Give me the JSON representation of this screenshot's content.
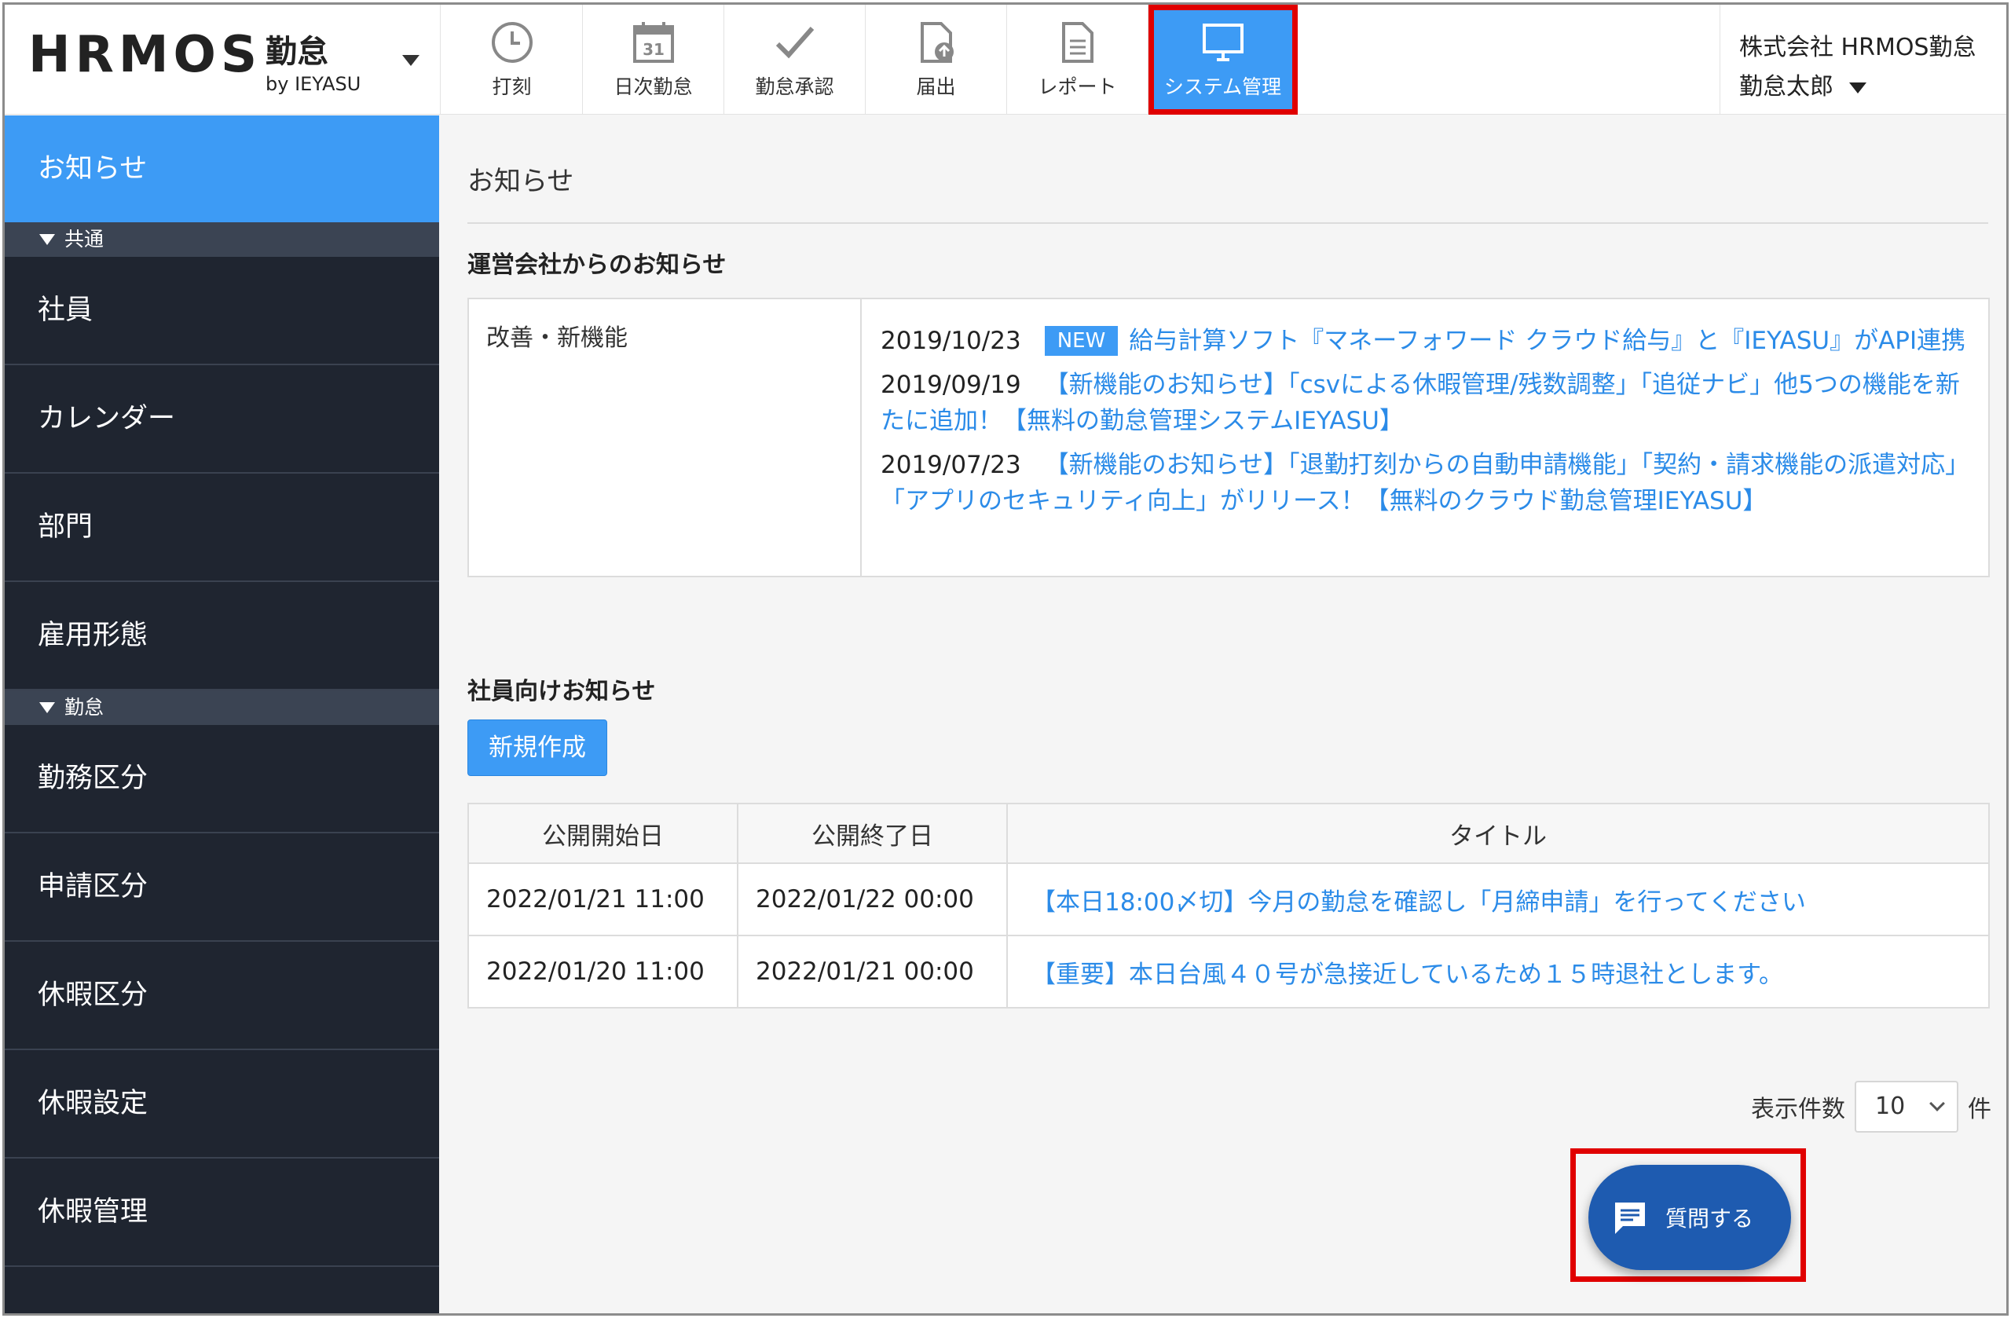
{
  "app": {
    "brand": "HRMOS",
    "brand_sub": "勤怠",
    "brand_by": "by IEYASU"
  },
  "nav": [
    {
      "label": "打刻",
      "icon": "clock-icon"
    },
    {
      "label": "日次勤怠",
      "icon": "calendar-icon",
      "day": "31"
    },
    {
      "label": "勤怠承認",
      "icon": "check-icon"
    },
    {
      "label": "届出",
      "icon": "upload-document-icon"
    },
    {
      "label": "レポート",
      "icon": "document-icon"
    },
    {
      "label": "システム管理",
      "icon": "monitor-icon",
      "active": true
    }
  ],
  "user": {
    "company": "株式会社 HRMOS勤怠",
    "name": "勤怠太郎"
  },
  "sidebar": {
    "active": "お知らせ",
    "groups": [
      {
        "label": "共通",
        "items": [
          "社員",
          "カレンダー",
          "部門",
          "雇用形態"
        ]
      },
      {
        "label": "勤怠",
        "items": [
          "勤務区分",
          "申請区分",
          "休暇区分",
          "休暇設定",
          "休暇管理"
        ]
      }
    ]
  },
  "main": {
    "title": "お知らせ",
    "operator_section": "運営会社からのお知らせ",
    "category": "改善・新機能",
    "notices": [
      {
        "date": "2019/10/23",
        "badge": "NEW",
        "text": "給与計算ソフト『マネーフォワード クラウド給与』と『IEYASU』がAPI連携"
      },
      {
        "date": "2019/09/19",
        "badge": "",
        "text": "【新機能のお知らせ】「csvによる休暇管理/残数調整」「追従ナビ」他5つの機能を新たに追加！【無料の勤怠管理システムIEYASU】"
      },
      {
        "date": "2019/07/23",
        "badge": "",
        "text": "【新機能のお知らせ】「退勤打刻からの自動申請機能」「契約・請求機能の派遣対応」「アプリのセキュリティ向上」がリリース！【無料のクラウド勤怠管理IEYASU】"
      }
    ],
    "employee_section": "社員向けお知らせ",
    "new_button": "新規作成",
    "table": {
      "headers": [
        "公開開始日",
        "公開終了日",
        "タイトル"
      ],
      "rows": [
        [
          "2022/01/21 11:00",
          "2022/01/22 00:00",
          "【本日18:00〆切】今月の勤怠を確認し「月締申請」を行ってください"
        ],
        [
          "2022/01/20 11:00",
          "2022/01/21 00:00",
          "【重要】本日台風４０号が急接近しているため１５時退社とします。"
        ]
      ]
    },
    "pager": {
      "label": "表示件数",
      "value": "10",
      "unit": "件"
    },
    "ask_button": "質問する"
  },
  "colors": {
    "accent": "#3d9bf5",
    "sidebar": "#1f2530",
    "link": "#2b8be8",
    "highlight": "#e00000",
    "ask": "#1e5bb0"
  }
}
